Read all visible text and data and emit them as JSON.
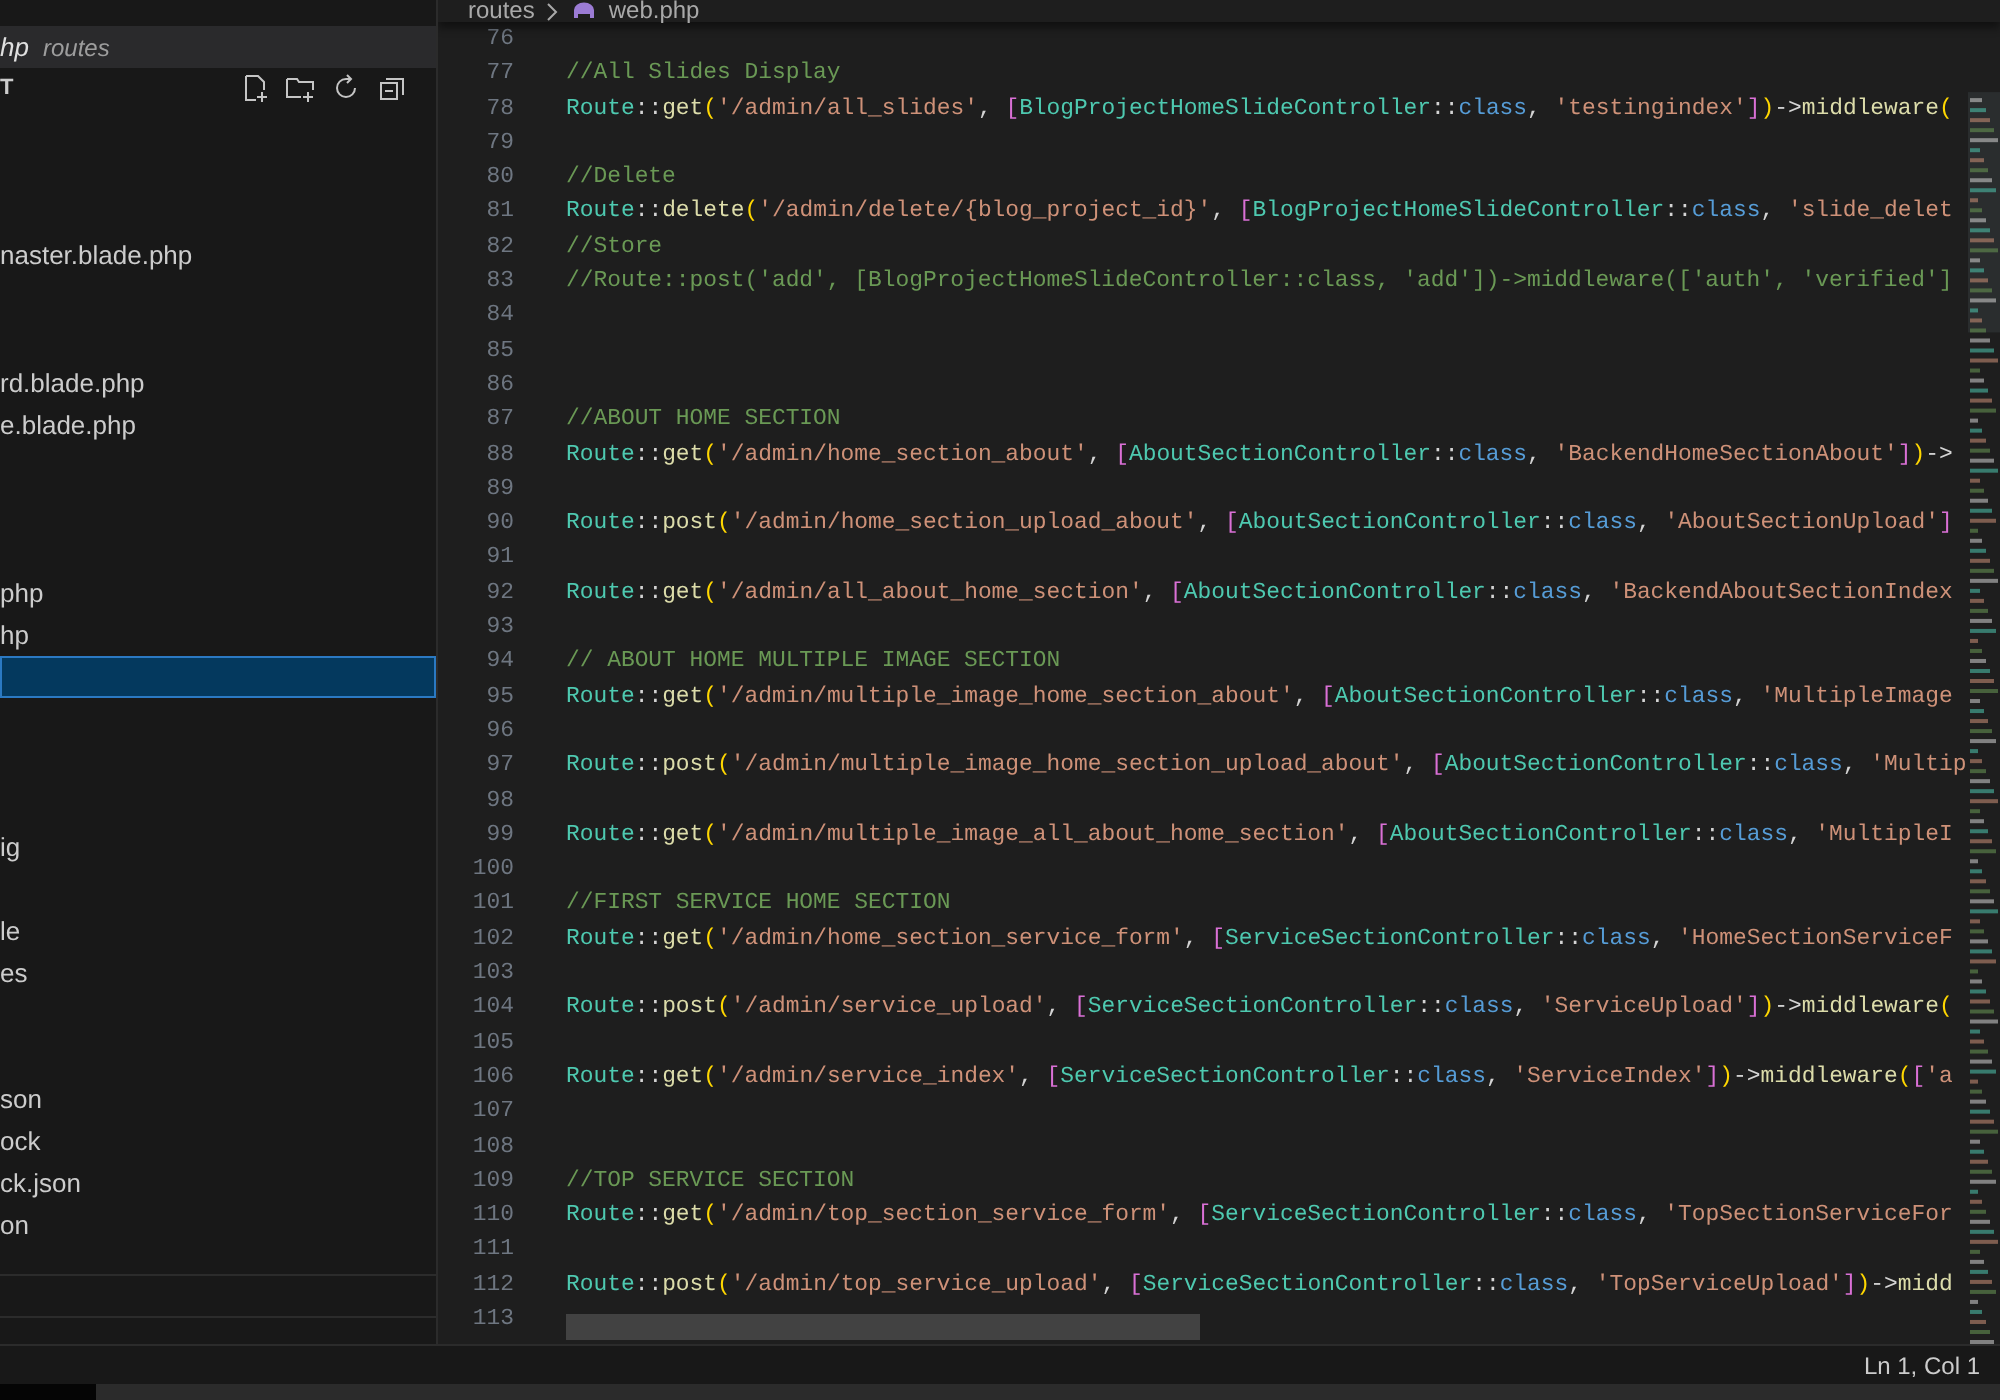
{
  "sidebar": {
    "open_editor": {
      "name": "hp",
      "folder": "routes"
    },
    "section_title": "T",
    "tree": [
      {
        "selected": false
      },
      {
        "selected": false
      },
      {
        "selected": false
      },
      {
        "label": "naster.blade.php",
        "selected": false
      },
      {
        "selected": false
      },
      {
        "selected": false
      },
      {
        "label": "rd.blade.php",
        "selected": false
      },
      {
        "label": "e.blade.php",
        "selected": false
      },
      {
        "selected": false
      },
      {
        "selected": false
      },
      {
        "selected": false
      },
      {
        "label": "php",
        "selected": false
      },
      {
        "label": "hp",
        "selected": false
      },
      {
        "selected": true
      },
      {
        "selected": false
      },
      {
        "selected": false
      },
      {
        "selected": false
      },
      {
        "label": "ig",
        "selected": false
      },
      {
        "selected": false
      },
      {
        "label": "le",
        "selected": false
      },
      {
        "label": "es",
        "selected": false
      },
      {
        "selected": false
      },
      {
        "selected": false
      },
      {
        "label": "son",
        "selected": false
      },
      {
        "label": "ock",
        "selected": false
      },
      {
        "label": "ck.json",
        "selected": false
      },
      {
        "label": "on",
        "selected": false
      }
    ]
  },
  "editor": {
    "breadcrumb": [
      "routes",
      "web.php"
    ],
    "lines": [
      {
        "number": "76"
      },
      {
        "number": "77",
        "tokens": [
          {
            "kind": "comment",
            "text": "//All Slides Display"
          }
        ]
      },
      {
        "number": "78",
        "tokens": [
          {
            "kind": "type",
            "text": "Route"
          },
          {
            "kind": "op",
            "text": "::"
          },
          {
            "kind": "fn",
            "text": "get"
          },
          {
            "kind": "paren",
            "text": "("
          },
          {
            "kind": "str",
            "text": "'/admin/all_slides'"
          },
          {
            "kind": "punct",
            "text": ", "
          },
          {
            "kind": "brk",
            "text": "["
          },
          {
            "kind": "type",
            "text": "BlogProjectHomeSlideController"
          },
          {
            "kind": "op",
            "text": "::"
          },
          {
            "kind": "kw",
            "text": "class"
          },
          {
            "kind": "punct",
            "text": ", "
          },
          {
            "kind": "str",
            "text": "'testingindex'"
          },
          {
            "kind": "brk",
            "text": "]"
          },
          {
            "kind": "paren",
            "text": ")"
          },
          {
            "kind": "op",
            "text": "->"
          },
          {
            "kind": "fn",
            "text": "middleware"
          },
          {
            "kind": "paren",
            "text": "("
          }
        ]
      },
      {
        "number": "79"
      },
      {
        "number": "80",
        "tokens": [
          {
            "kind": "comment",
            "text": "//Delete"
          }
        ]
      },
      {
        "number": "81",
        "tokens": [
          {
            "kind": "type",
            "text": "Route"
          },
          {
            "kind": "op",
            "text": "::"
          },
          {
            "kind": "fn",
            "text": "delete"
          },
          {
            "kind": "paren",
            "text": "("
          },
          {
            "kind": "str",
            "text": "'/admin/delete/{blog_project_id}'"
          },
          {
            "kind": "punct",
            "text": ", "
          },
          {
            "kind": "brk",
            "text": "["
          },
          {
            "kind": "type",
            "text": "BlogProjectHomeSlideController"
          },
          {
            "kind": "op",
            "text": "::"
          },
          {
            "kind": "kw",
            "text": "class"
          },
          {
            "kind": "punct",
            "text": ", "
          },
          {
            "kind": "str",
            "text": "'slide_delet"
          }
        ]
      },
      {
        "number": "82",
        "tokens": [
          {
            "kind": "comment",
            "text": "//Store"
          }
        ]
      },
      {
        "number": "83",
        "tokens": [
          {
            "kind": "comment",
            "text": "//Route::post('add', [BlogProjectHomeSlideController::class, 'add'])->middleware(['auth', 'verified']"
          }
        ]
      },
      {
        "number": "84"
      },
      {
        "number": "85"
      },
      {
        "number": "86"
      },
      {
        "number": "87",
        "tokens": [
          {
            "kind": "comment",
            "text": "//ABOUT HOME SECTION"
          }
        ]
      },
      {
        "number": "88",
        "tokens": [
          {
            "kind": "type",
            "text": "Route"
          },
          {
            "kind": "op",
            "text": "::"
          },
          {
            "kind": "fn",
            "text": "get"
          },
          {
            "kind": "paren",
            "text": "("
          },
          {
            "kind": "str",
            "text": "'/admin/home_section_about'"
          },
          {
            "kind": "punct",
            "text": ", "
          },
          {
            "kind": "brk",
            "text": "["
          },
          {
            "kind": "type",
            "text": "AboutSectionController"
          },
          {
            "kind": "op",
            "text": "::"
          },
          {
            "kind": "kw",
            "text": "class"
          },
          {
            "kind": "punct",
            "text": ", "
          },
          {
            "kind": "str",
            "text": "'BackendHomeSectionAbout'"
          },
          {
            "kind": "brk",
            "text": "]"
          },
          {
            "kind": "paren",
            "text": ")"
          },
          {
            "kind": "op",
            "text": "->"
          }
        ]
      },
      {
        "number": "89"
      },
      {
        "number": "90",
        "tokens": [
          {
            "kind": "type",
            "text": "Route"
          },
          {
            "kind": "op",
            "text": "::"
          },
          {
            "kind": "fn",
            "text": "post"
          },
          {
            "kind": "paren",
            "text": "("
          },
          {
            "kind": "str",
            "text": "'/admin/home_section_upload_about'"
          },
          {
            "kind": "punct",
            "text": ", "
          },
          {
            "kind": "brk",
            "text": "["
          },
          {
            "kind": "type",
            "text": "AboutSectionController"
          },
          {
            "kind": "op",
            "text": "::"
          },
          {
            "kind": "kw",
            "text": "class"
          },
          {
            "kind": "punct",
            "text": ", "
          },
          {
            "kind": "str",
            "text": "'AboutSectionUpload'"
          },
          {
            "kind": "brk",
            "text": "]"
          }
        ]
      },
      {
        "number": "91"
      },
      {
        "number": "92",
        "tokens": [
          {
            "kind": "type",
            "text": "Route"
          },
          {
            "kind": "op",
            "text": "::"
          },
          {
            "kind": "fn",
            "text": "get"
          },
          {
            "kind": "paren",
            "text": "("
          },
          {
            "kind": "str",
            "text": "'/admin/all_about_home_section'"
          },
          {
            "kind": "punct",
            "text": ", "
          },
          {
            "kind": "brk",
            "text": "["
          },
          {
            "kind": "type",
            "text": "AboutSectionController"
          },
          {
            "kind": "op",
            "text": "::"
          },
          {
            "kind": "kw",
            "text": "class"
          },
          {
            "kind": "punct",
            "text": ", "
          },
          {
            "kind": "str",
            "text": "'BackendAboutSectionIndex"
          }
        ]
      },
      {
        "number": "93"
      },
      {
        "number": "94",
        "tokens": [
          {
            "kind": "comment",
            "text": "// ABOUT HOME MULTIPLE IMAGE SECTION"
          }
        ]
      },
      {
        "number": "95",
        "tokens": [
          {
            "kind": "type",
            "text": "Route"
          },
          {
            "kind": "op",
            "text": "::"
          },
          {
            "kind": "fn",
            "text": "get"
          },
          {
            "kind": "paren",
            "text": "("
          },
          {
            "kind": "str",
            "text": "'/admin/multiple_image_home_section_about'"
          },
          {
            "kind": "punct",
            "text": ", "
          },
          {
            "kind": "brk",
            "text": "["
          },
          {
            "kind": "type",
            "text": "AboutSectionController"
          },
          {
            "kind": "op",
            "text": "::"
          },
          {
            "kind": "kw",
            "text": "class"
          },
          {
            "kind": "punct",
            "text": ", "
          },
          {
            "kind": "str",
            "text": "'MultipleImage"
          }
        ]
      },
      {
        "number": "96"
      },
      {
        "number": "97",
        "tokens": [
          {
            "kind": "type",
            "text": "Route"
          },
          {
            "kind": "op",
            "text": "::"
          },
          {
            "kind": "fn",
            "text": "post"
          },
          {
            "kind": "paren",
            "text": "("
          },
          {
            "kind": "str",
            "text": "'/admin/multiple_image_home_section_upload_about'"
          },
          {
            "kind": "punct",
            "text": ", "
          },
          {
            "kind": "brk",
            "text": "["
          },
          {
            "kind": "type",
            "text": "AboutSectionController"
          },
          {
            "kind": "op",
            "text": "::"
          },
          {
            "kind": "kw",
            "text": "class"
          },
          {
            "kind": "punct",
            "text": ", "
          },
          {
            "kind": "str",
            "text": "'Multip"
          }
        ]
      },
      {
        "number": "98"
      },
      {
        "number": "99",
        "tokens": [
          {
            "kind": "type",
            "text": "Route"
          },
          {
            "kind": "op",
            "text": "::"
          },
          {
            "kind": "fn",
            "text": "get"
          },
          {
            "kind": "paren",
            "text": "("
          },
          {
            "kind": "str",
            "text": "'/admin/multiple_image_all_about_home_section'"
          },
          {
            "kind": "punct",
            "text": ", "
          },
          {
            "kind": "brk",
            "text": "["
          },
          {
            "kind": "type",
            "text": "AboutSectionController"
          },
          {
            "kind": "op",
            "text": "::"
          },
          {
            "kind": "kw",
            "text": "class"
          },
          {
            "kind": "punct",
            "text": ", "
          },
          {
            "kind": "str",
            "text": "'MultipleI"
          }
        ]
      },
      {
        "number": "100"
      },
      {
        "number": "101",
        "tokens": [
          {
            "kind": "comment",
            "text": "//FIRST SERVICE HOME SECTION"
          }
        ]
      },
      {
        "number": "102",
        "tokens": [
          {
            "kind": "type",
            "text": "Route"
          },
          {
            "kind": "op",
            "text": "::"
          },
          {
            "kind": "fn",
            "text": "get"
          },
          {
            "kind": "paren",
            "text": "("
          },
          {
            "kind": "str",
            "text": "'/admin/home_section_service_form'"
          },
          {
            "kind": "punct",
            "text": ", "
          },
          {
            "kind": "brk",
            "text": "["
          },
          {
            "kind": "type",
            "text": "ServiceSectionController"
          },
          {
            "kind": "op",
            "text": "::"
          },
          {
            "kind": "kw",
            "text": "class"
          },
          {
            "kind": "punct",
            "text": ", "
          },
          {
            "kind": "str",
            "text": "'HomeSectionServiceF"
          }
        ]
      },
      {
        "number": "103"
      },
      {
        "number": "104",
        "tokens": [
          {
            "kind": "type",
            "text": "Route"
          },
          {
            "kind": "op",
            "text": "::"
          },
          {
            "kind": "fn",
            "text": "post"
          },
          {
            "kind": "paren",
            "text": "("
          },
          {
            "kind": "str",
            "text": "'/admin/service_upload'"
          },
          {
            "kind": "punct",
            "text": ", "
          },
          {
            "kind": "brk",
            "text": "["
          },
          {
            "kind": "type",
            "text": "ServiceSectionController"
          },
          {
            "kind": "op",
            "text": "::"
          },
          {
            "kind": "kw",
            "text": "class"
          },
          {
            "kind": "punct",
            "text": ", "
          },
          {
            "kind": "str",
            "text": "'ServiceUpload'"
          },
          {
            "kind": "brk",
            "text": "]"
          },
          {
            "kind": "paren",
            "text": ")"
          },
          {
            "kind": "op",
            "text": "->"
          },
          {
            "kind": "fn",
            "text": "middleware"
          },
          {
            "kind": "paren",
            "text": "("
          }
        ]
      },
      {
        "number": "105"
      },
      {
        "number": "106",
        "tokens": [
          {
            "kind": "type",
            "text": "Route"
          },
          {
            "kind": "op",
            "text": "::"
          },
          {
            "kind": "fn",
            "text": "get"
          },
          {
            "kind": "paren",
            "text": "("
          },
          {
            "kind": "str",
            "text": "'/admin/service_index'"
          },
          {
            "kind": "punct",
            "text": ", "
          },
          {
            "kind": "brk",
            "text": "["
          },
          {
            "kind": "type",
            "text": "ServiceSectionController"
          },
          {
            "kind": "op",
            "text": "::"
          },
          {
            "kind": "kw",
            "text": "class"
          },
          {
            "kind": "punct",
            "text": ", "
          },
          {
            "kind": "str",
            "text": "'ServiceIndex'"
          },
          {
            "kind": "brk",
            "text": "]"
          },
          {
            "kind": "paren",
            "text": ")"
          },
          {
            "kind": "op",
            "text": "->"
          },
          {
            "kind": "fn",
            "text": "middleware"
          },
          {
            "kind": "paren",
            "text": "("
          },
          {
            "kind": "brk",
            "text": "["
          },
          {
            "kind": "str",
            "text": "'a"
          }
        ]
      },
      {
        "number": "107"
      },
      {
        "number": "108"
      },
      {
        "number": "109",
        "tokens": [
          {
            "kind": "comment",
            "text": "//TOP SERVICE SECTION"
          }
        ]
      },
      {
        "number": "110",
        "tokens": [
          {
            "kind": "type",
            "text": "Route"
          },
          {
            "kind": "op",
            "text": "::"
          },
          {
            "kind": "fn",
            "text": "get"
          },
          {
            "kind": "paren",
            "text": "("
          },
          {
            "kind": "str",
            "text": "'/admin/top_section_service_form'"
          },
          {
            "kind": "punct",
            "text": ", "
          },
          {
            "kind": "brk",
            "text": "["
          },
          {
            "kind": "type",
            "text": "ServiceSectionController"
          },
          {
            "kind": "op",
            "text": "::"
          },
          {
            "kind": "kw",
            "text": "class"
          },
          {
            "kind": "punct",
            "text": ", "
          },
          {
            "kind": "str",
            "text": "'TopSectionServiceFor"
          }
        ]
      },
      {
        "number": "111"
      },
      {
        "number": "112",
        "tokens": [
          {
            "kind": "type",
            "text": "Route"
          },
          {
            "kind": "op",
            "text": "::"
          },
          {
            "kind": "fn",
            "text": "post"
          },
          {
            "kind": "paren",
            "text": "("
          },
          {
            "kind": "str",
            "text": "'/admin/top_service_upload'"
          },
          {
            "kind": "punct",
            "text": ", "
          },
          {
            "kind": "brk",
            "text": "["
          },
          {
            "kind": "type",
            "text": "ServiceSectionController"
          },
          {
            "kind": "op",
            "text": "::"
          },
          {
            "kind": "kw",
            "text": "class"
          },
          {
            "kind": "punct",
            "text": ", "
          },
          {
            "kind": "str",
            "text": "'TopServiceUpload'"
          },
          {
            "kind": "brk",
            "text": "]"
          },
          {
            "kind": "paren",
            "text": ")"
          },
          {
            "kind": "op",
            "text": "->"
          },
          {
            "kind": "fn",
            "text": "midd"
          }
        ]
      },
      {
        "number": "113"
      }
    ]
  },
  "status_bar": {
    "position": "Ln 1, Col 1"
  }
}
